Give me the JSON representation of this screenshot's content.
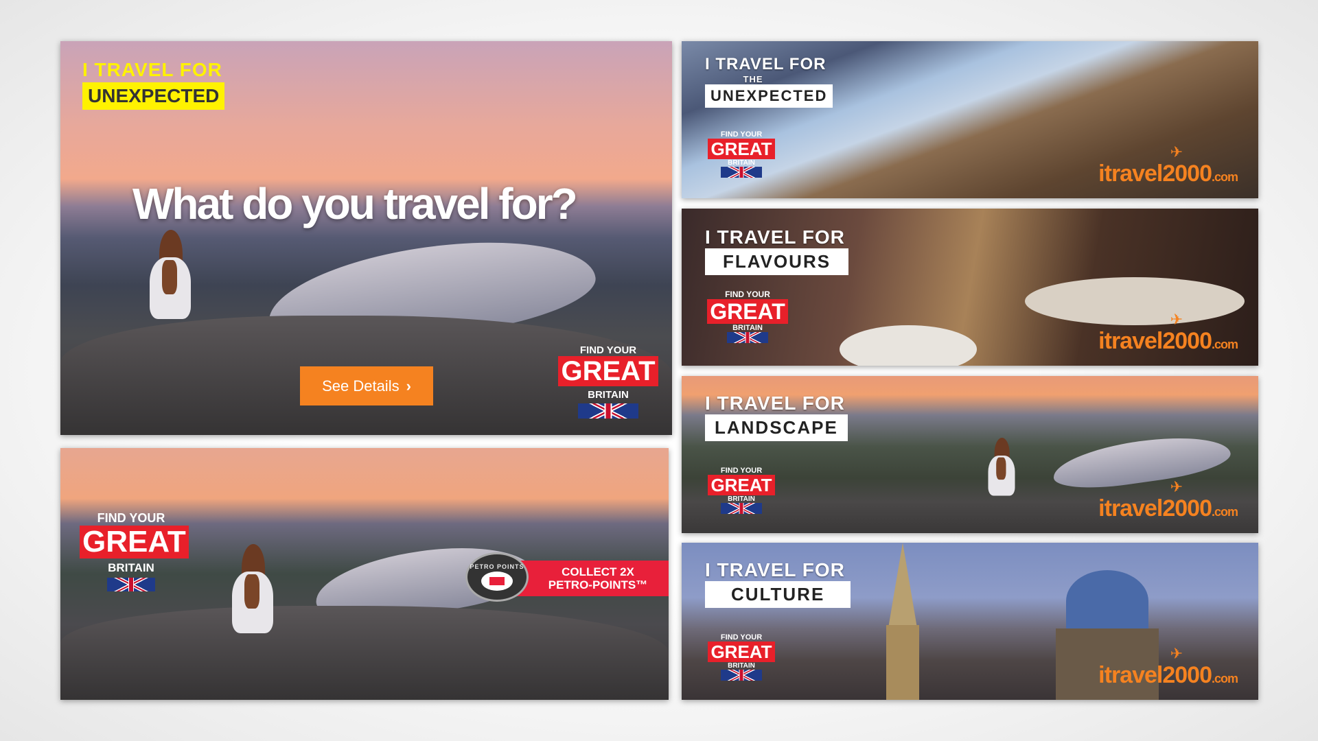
{
  "main_ad": {
    "tag_line": "I TRAVEL FOR",
    "tag_word": "UNEXPECTED",
    "headline": "What do you travel for?",
    "cta_label": "See Details",
    "find_your": "FIND YOUR",
    "great": "GREAT",
    "britain": "BRITAIN",
    "colors": {
      "tag_bg": "#fff200",
      "cta": "#f58220",
      "great": "#e8202a"
    }
  },
  "petro_ad": {
    "find_your": "FIND YOUR",
    "great": "GREAT",
    "britain": "BRITAIN",
    "petro_logo_text": "PETRO POINTS",
    "promo_line1": "COLLECT 2X",
    "promo_line2": "PETRO-POINTS™",
    "colors": {
      "promo_bg": "#e8203a"
    }
  },
  "banners": [
    {
      "tag_line": "I TRAVEL FOR",
      "tag_sub": "THE",
      "tag_word": "UNEXPECTED",
      "find_your": "FIND YOUR",
      "great": "GREAT",
      "britain": "BRITAIN",
      "logo": "itravel2000",
      "logo_suffix": ".com"
    },
    {
      "tag_line": "I TRAVEL FOR",
      "tag_word": "FLAVOURS",
      "find_your": "FIND YOUR",
      "great": "GREAT",
      "britain": "BRITAIN",
      "logo": "itravel2000",
      "logo_suffix": ".com"
    },
    {
      "tag_line": "I TRAVEL FOR",
      "tag_word": "LANDSCAPE",
      "find_your": "FIND YOUR",
      "great": "GREAT",
      "britain": "BRITAIN",
      "logo": "itravel2000",
      "logo_suffix": ".com"
    },
    {
      "tag_line": "I TRAVEL FOR",
      "tag_word": "CULTURE",
      "find_your": "FIND YOUR",
      "great": "GREAT",
      "britain": "BRITAIN",
      "logo": "itravel2000",
      "logo_suffix": ".com"
    }
  ],
  "icons": {
    "cta": "chevron-right-icon",
    "flag": "union-jack-flag",
    "logo": "airplane-icon"
  }
}
